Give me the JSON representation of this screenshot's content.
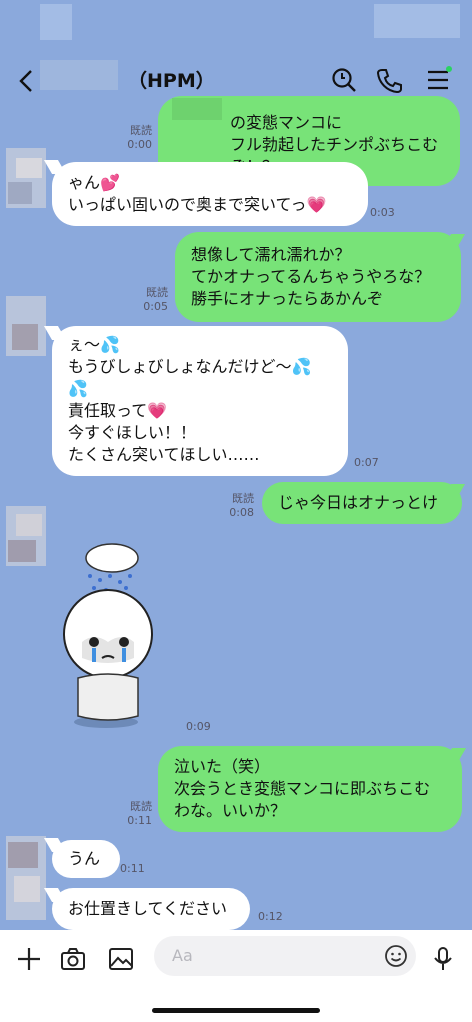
{
  "header": {
    "title": "（HPM）"
  },
  "messages": [
    {
      "id": "m1",
      "side": "me",
      "read": "既読",
      "time": "0:00",
      "text": "の変態マンコに\nフル勃起したチンポぶちこむぞ！？"
    },
    {
      "id": "m2",
      "side": "them",
      "time": "0:03",
      "text": "ゃん💕\nいっぱい固いので奥まで突いてっ💗"
    },
    {
      "id": "m3",
      "side": "me",
      "read": "既読",
      "time": "0:05",
      "text": "想像して濡れ濡れか？\nてかオナってるんちゃうやろな？\n勝手にオナったらあかんぞ"
    },
    {
      "id": "m4",
      "side": "them",
      "time": "0:07",
      "text": "ぇ〜💦\nもうびしょびしょなんだけど〜💦\n💦\n責任取って💗\n今すぐほしい！！\nたくさん突いてほしい……"
    },
    {
      "id": "m5",
      "side": "me",
      "read": "既読",
      "time": "0:08",
      "text": "じゃ今日はオナっとけ"
    },
    {
      "id": "m6",
      "side": "them",
      "time": "0:09",
      "sticker": "crying-under-cloud"
    },
    {
      "id": "m7",
      "side": "me",
      "read": "既読",
      "time": "0:11",
      "text": "泣いた（笑）\n次会うとき変態マンコに即ぶちこむ\nわな。いいか？"
    },
    {
      "id": "m8",
      "side": "them",
      "time": "0:11",
      "text": "うん"
    },
    {
      "id": "m9",
      "side": "them",
      "time": "0:12",
      "text": "お仕置きしてください"
    }
  ],
  "input": {
    "placeholder": "Aa"
  },
  "icons": [
    "back-icon",
    "search-icon",
    "phone-icon",
    "menu-icon",
    "plus-icon",
    "camera-icon",
    "image-icon",
    "emoji-icon",
    "mic-icon"
  ]
}
